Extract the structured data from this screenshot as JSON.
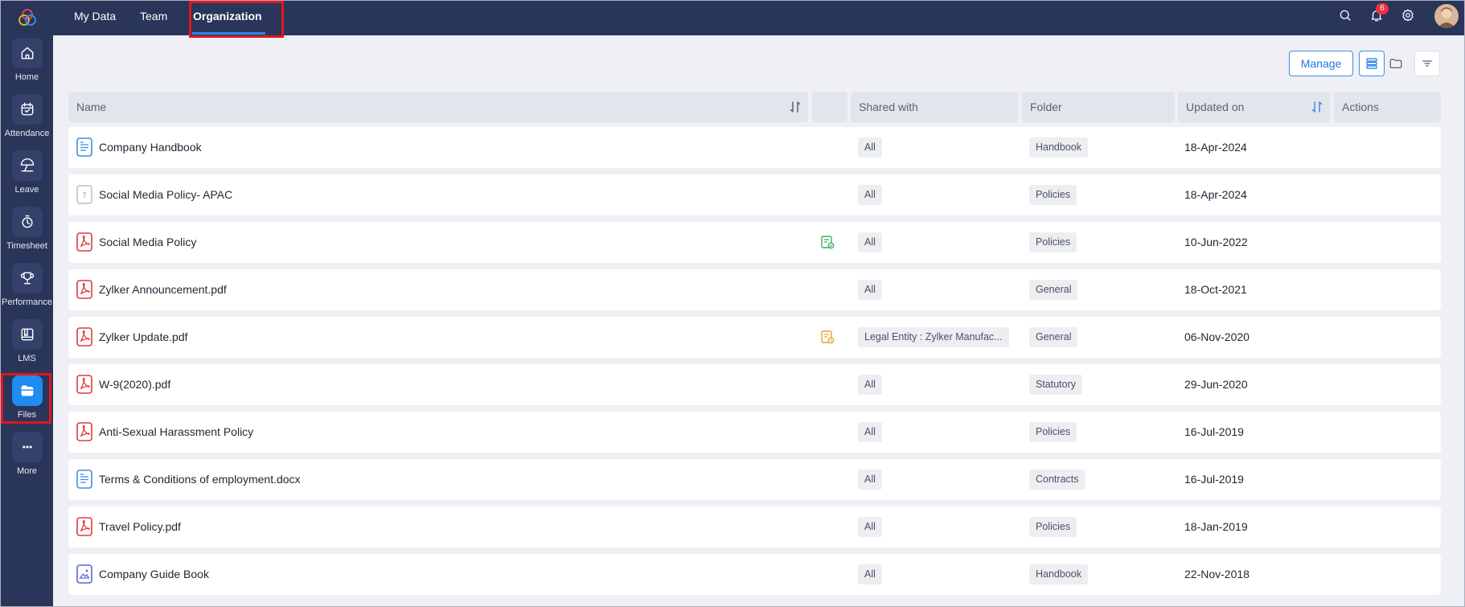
{
  "nav_tabs": [
    {
      "label": "My Data"
    },
    {
      "label": "Team"
    },
    {
      "label": "Organization",
      "active": true
    }
  ],
  "notifications": {
    "count": "6"
  },
  "sidebar": {
    "items": [
      {
        "label": "Home",
        "icon": "home-icon"
      },
      {
        "label": "Attendance",
        "icon": "calendar-check-icon"
      },
      {
        "label": "Leave",
        "icon": "umbrella-icon"
      },
      {
        "label": "Timesheet",
        "icon": "timer-icon"
      },
      {
        "label": "Performance",
        "icon": "trophy-icon"
      },
      {
        "label": "LMS",
        "icon": "book-icon"
      },
      {
        "label": "Files",
        "icon": "folder-icon",
        "active": true
      },
      {
        "label": "More",
        "icon": "more-icon"
      }
    ]
  },
  "toolbar": {
    "manage_label": "Manage",
    "view_modes": [
      "list-view-icon",
      "folder-view-icon"
    ],
    "filter_icon": "filter-icon"
  },
  "table": {
    "columns": [
      "Name",
      "",
      "Shared with",
      "Folder",
      "Updated on",
      "Actions"
    ],
    "rows": [
      {
        "name": "Company Handbook",
        "icon": "doc-icon",
        "status_icon": null,
        "shared_with": "All",
        "folder": "Handbook",
        "updated_on": "18-Apr-2024"
      },
      {
        "name": "Social Media Policy- APAC",
        "icon": "unknown-file-icon",
        "status_icon": null,
        "shared_with": "All",
        "folder": "Policies",
        "updated_on": "18-Apr-2024"
      },
      {
        "name": "Social Media Policy",
        "icon": "pdf-icon",
        "status_icon": "green-acknowledge-icon",
        "shared_with": "All",
        "folder": "Policies",
        "updated_on": "10-Jun-2022"
      },
      {
        "name": "Zylker Announcement.pdf",
        "icon": "pdf-icon",
        "status_icon": null,
        "shared_with": "All",
        "folder": "General",
        "updated_on": "18-Oct-2021"
      },
      {
        "name": "Zylker Update.pdf",
        "icon": "pdf-icon",
        "status_icon": "orange-acknowledge-icon",
        "shared_with": "Legal Entity : Zylker Manufac...",
        "folder": "General",
        "updated_on": "06-Nov-2020"
      },
      {
        "name": "W-9(2020).pdf",
        "icon": "pdf-icon",
        "status_icon": null,
        "shared_with": "All",
        "folder": "Statutory",
        "updated_on": "29-Jun-2020"
      },
      {
        "name": "Anti-Sexual Harassment Policy",
        "icon": "pdf-icon",
        "status_icon": null,
        "shared_with": "All",
        "folder": "Policies",
        "updated_on": "16-Jul-2019"
      },
      {
        "name": "Terms & Conditions of employment.docx",
        "icon": "doc-icon",
        "status_icon": null,
        "shared_with": "All",
        "folder": "Contracts",
        "updated_on": "16-Jul-2019"
      },
      {
        "name": "Travel Policy.pdf",
        "icon": "pdf-icon",
        "status_icon": null,
        "shared_with": "All",
        "folder": "Policies",
        "updated_on": "18-Jan-2019"
      },
      {
        "name": "Company Guide Book",
        "icon": "image-doc-icon",
        "status_icon": null,
        "shared_with": "All",
        "folder": "Handbook",
        "updated_on": "22-Nov-2018"
      }
    ]
  },
  "colors": {
    "nav_bg": "#293559",
    "accent": "#1f8cf0",
    "highlight_box": "#e0161e",
    "pdf_red": "#e03a3a",
    "doc_blue": "#3d8de0"
  }
}
